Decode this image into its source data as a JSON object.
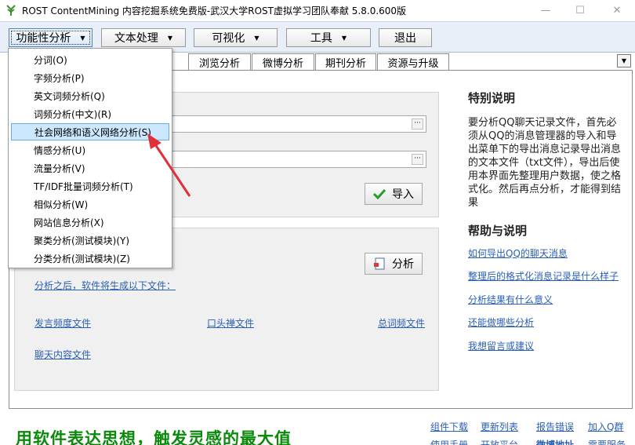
{
  "window": {
    "title": "ROST ContentMining 内容挖掘系统免费版-武汉大学ROST虚拟学习团队奉献  5.8.0.600版",
    "controls": {
      "minimize": "—",
      "maximize": "☐",
      "close": "✕"
    }
  },
  "toolbar": {
    "menus": [
      "功能性分析",
      "文本处理",
      "可视化",
      "工具"
    ],
    "exit_label": "退出"
  },
  "tabs": [
    "浏览分析",
    "微博分析",
    "期刊分析",
    "资源与升级"
  ],
  "import_button": "导入",
  "analyze_button": "分析",
  "main_links": {
    "after_analysis": "分析之后，软件将生成以下文件：",
    "files": [
      "发言频度文件",
      "口头禅文件",
      "总词频文件",
      "聊天内容文件"
    ]
  },
  "special_note": {
    "heading": "特别说明",
    "text": "要分析QQ聊天记录文件，首先必须从QQ的消息管理器的导入和导出菜单下的导出消息记录导出消息的文本文件（txt文件），导出后使用本界面先整理用户数据，使之格式化。然后再点分析，才能得到结果"
  },
  "help": {
    "heading": "帮助与说明",
    "links": [
      "如何导出QQ的聊天消息",
      "整理后的格式化消息记录是什么样子",
      "分析结果有什么意义",
      "还能做哪些分析",
      "我想留言或建议"
    ]
  },
  "dropdown": {
    "items": [
      "分词(O)",
      "字频分析(P)",
      "英文词频分析(Q)",
      "词频分析(中文)(R)",
      "社会网络和语义网络分析(S)",
      "情感分析(U)",
      "流量分析(V)",
      "TF/IDF批量词频分析(T)",
      "相似分析(W)",
      "网站信息分析(X)",
      "聚类分析(测试模块)(Y)",
      "分类分析(测试模块)(Z)"
    ],
    "highlighted_index": 4
  },
  "footer": {
    "slogan": "用软件表达思想，触发灵感的最大值",
    "links_row1": [
      "组件下载",
      "更新列表",
      "报告错误",
      "加入Q群"
    ],
    "links_row2": [
      "使用手册",
      "开放平台",
      "微博地址",
      "需要服务"
    ]
  },
  "colors": {
    "toolbar_bg": "#e8eff8",
    "link": "#2b5fb3",
    "slogan": "#0a8a0a",
    "highlight": "#cce8ff",
    "arrow": "#e0303a"
  }
}
